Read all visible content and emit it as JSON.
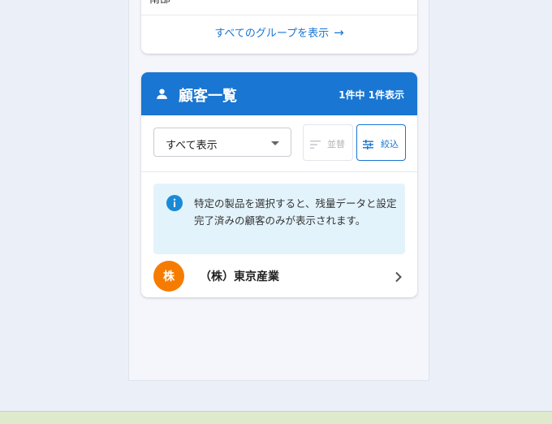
{
  "groups_card": {
    "cut_text": "南部",
    "show_all_label": "すべてのグループを表示",
    "arrow_icon": "arrow-right-icon"
  },
  "customers": {
    "title": "顧客一覧",
    "count_text": "1件中 1件表示",
    "header_icon": "user-icon",
    "accent_color": "#1976d2",
    "filter_select": {
      "value": "すべて表示"
    },
    "sort_button": {
      "label": "並替",
      "icon": "sort-icon",
      "enabled": false
    },
    "filter_button": {
      "label": "絞込",
      "icon": "tune-icon"
    },
    "info_message": "特定の製品を選択すると、残量データと設定完了済みの顧客のみが表示されます。",
    "items": [
      {
        "avatar_text": "株",
        "avatar_color": "#f57c00",
        "name": "（株）東京産業"
      }
    ]
  }
}
